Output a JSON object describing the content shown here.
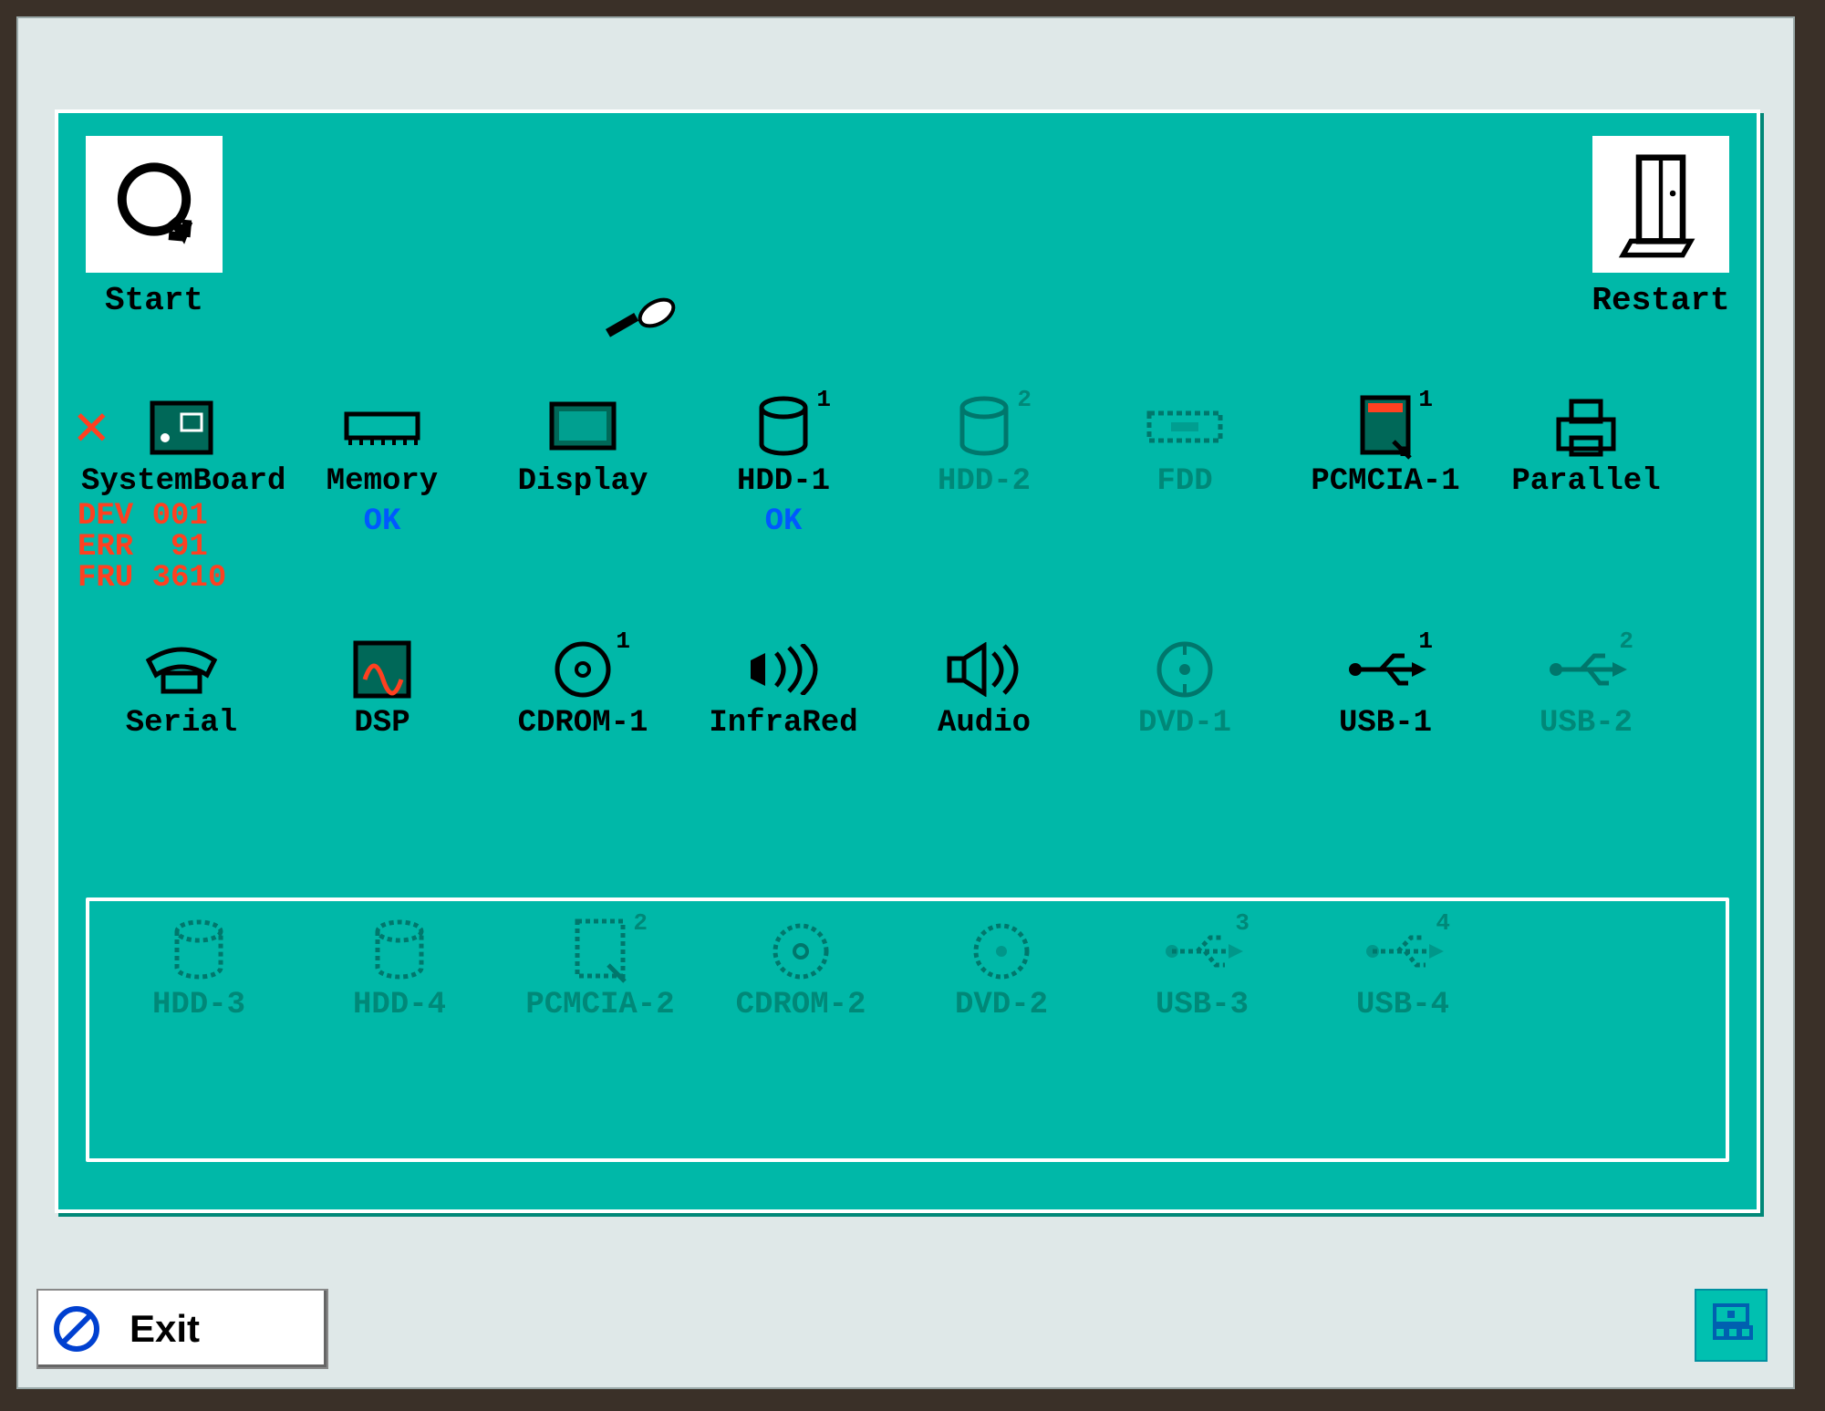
{
  "top": {
    "start_label": "Start",
    "restart_label": "Restart"
  },
  "devices_row1": [
    {
      "label": "SystemBoard",
      "error": {
        "dev": "DEV 001",
        "err": "ERR  91",
        "fru": "FRU 3610"
      }
    },
    {
      "label": "Memory",
      "status": "OK"
    },
    {
      "label": "Display"
    },
    {
      "label": "HDD-1",
      "sup": "1",
      "status": "OK"
    },
    {
      "label": "HDD-2",
      "sup": "2",
      "dim": true
    },
    {
      "label": "FDD",
      "dim": true
    },
    {
      "label": "PCMCIA-1",
      "sup": "1"
    },
    {
      "label": "Parallel"
    }
  ],
  "devices_row2": [
    {
      "label": "Serial"
    },
    {
      "label": "DSP"
    },
    {
      "label": "CDROM-1",
      "sup": "1"
    },
    {
      "label": "InfraRed"
    },
    {
      "label": "Audio"
    },
    {
      "label": "DVD-1",
      "dim": true
    },
    {
      "label": "USB-1",
      "sup": "1"
    },
    {
      "label": "USB-2",
      "sup": "2",
      "dim": true
    }
  ],
  "devices_row3": [
    {
      "label": "HDD-3",
      "dim": true
    },
    {
      "label": "HDD-4",
      "dim": true
    },
    {
      "label": "PCMCIA-2",
      "sup": "2",
      "dim": true
    },
    {
      "label": "CDROM-2",
      "dim": true
    },
    {
      "label": "DVD-2",
      "dim": true
    },
    {
      "label": "USB-3",
      "sup": "3",
      "dim": true
    },
    {
      "label": "USB-4",
      "sup": "4",
      "dim": true
    }
  ],
  "footer": {
    "exit_label": "Exit"
  }
}
